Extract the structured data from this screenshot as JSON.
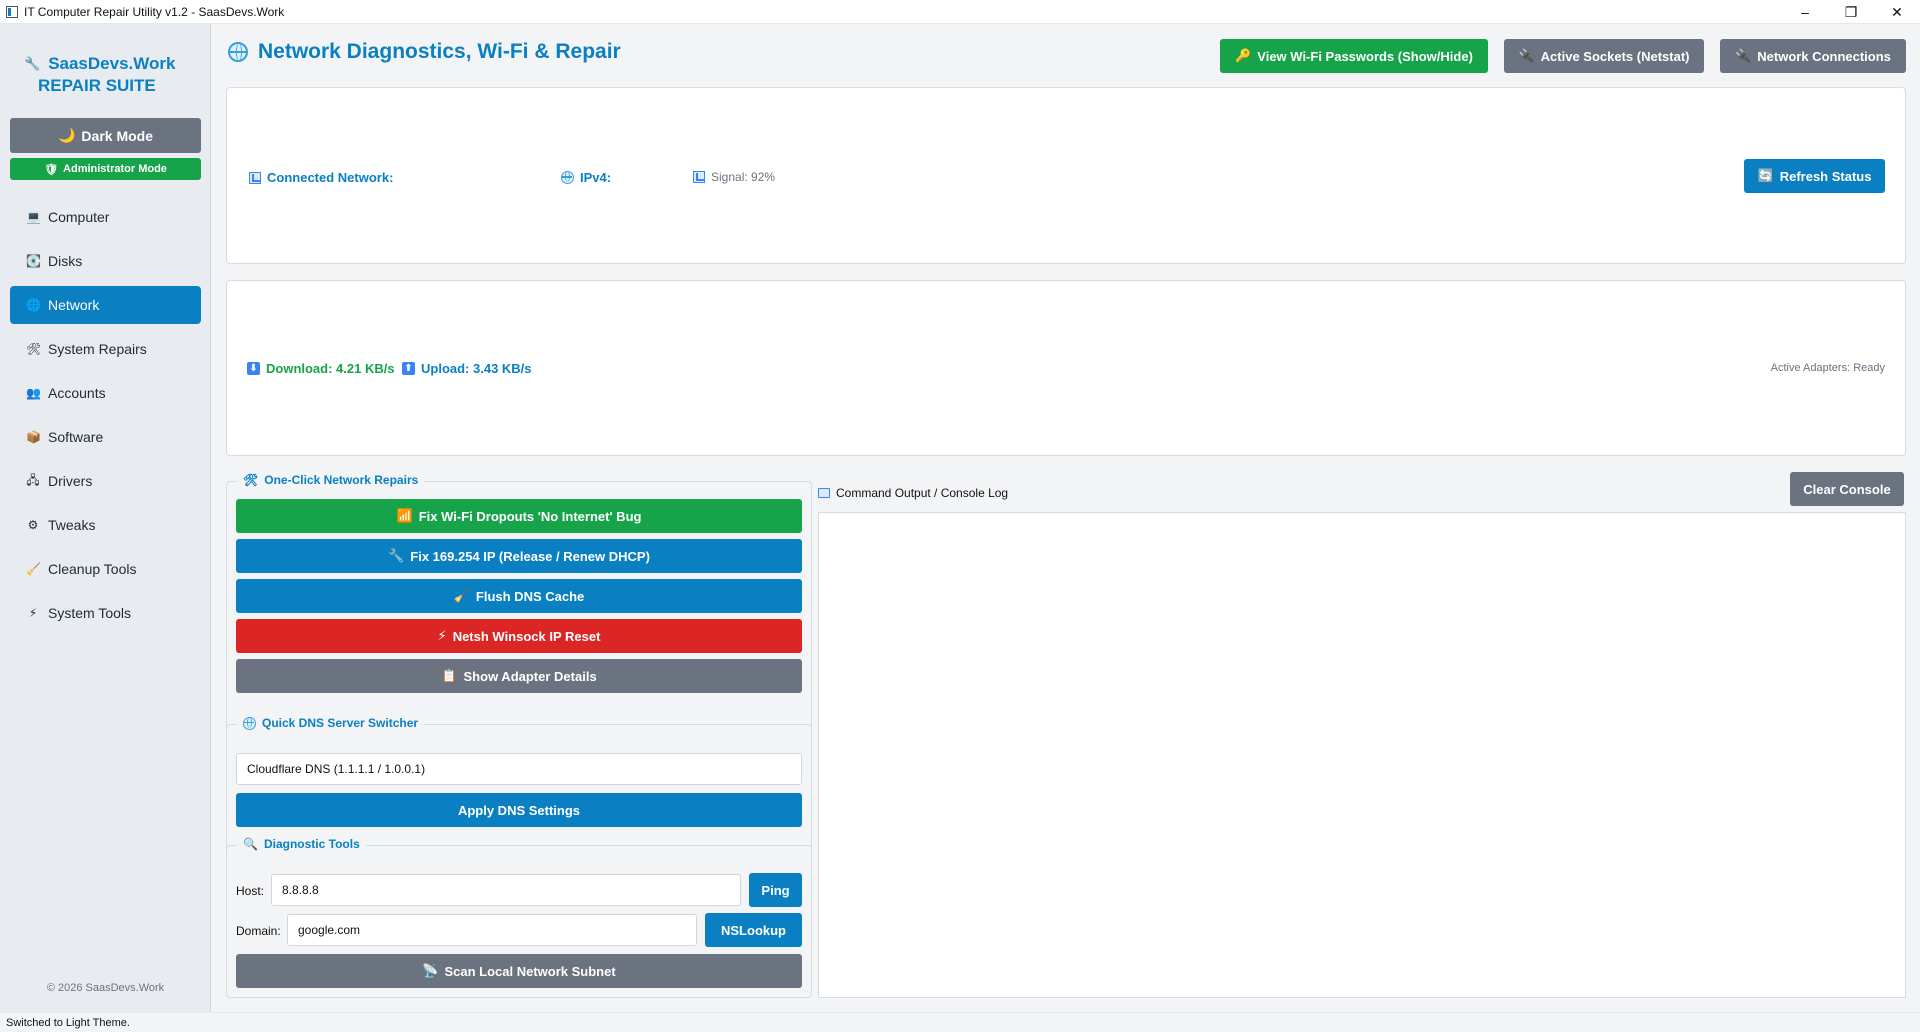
{
  "window": {
    "title": "IT Computer Repair Utility v1.2 - SaasDevs.Work",
    "minimize": "–",
    "maximize": "❐",
    "close": "✕"
  },
  "sidebar": {
    "brand_line1": "SaasDevs.Work",
    "brand_line2": "REPAIR SUITE",
    "dark_mode": "Dark Mode",
    "admin_mode": "Administrator Mode",
    "items": [
      {
        "label": "Computer",
        "icon": "💻"
      },
      {
        "label": "Disks",
        "icon": "💽"
      },
      {
        "label": "Network",
        "icon": "🌐"
      },
      {
        "label": "System Repairs",
        "icon": "🛠"
      },
      {
        "label": "Accounts",
        "icon": "👥"
      },
      {
        "label": "Software",
        "icon": "📦"
      },
      {
        "label": "Drivers",
        "icon": "🖧"
      },
      {
        "label": "Tweaks",
        "icon": "⚙"
      },
      {
        "label": "Cleanup Tools",
        "icon": "🧹"
      },
      {
        "label": "System Tools",
        "icon": "⚡"
      }
    ],
    "active_item": "Network",
    "copyright": "© 2026 SaasDevs.Work"
  },
  "header": {
    "title": "Network Diagnostics, Wi-Fi & Repair",
    "view_wifi_passwords": "View Wi-Fi Passwords (Show/Hide)",
    "active_sockets": "Active Sockets (Netstat)",
    "network_connections": "Network Connections"
  },
  "status": {
    "connected_label": "Connected Network:",
    "ipv4_label": "IPv4:",
    "signal": "Signal: 92%",
    "refresh": "Refresh Status"
  },
  "speed": {
    "download": "Download: 4.21 KB/s",
    "upload": "Upload: 3.43 KB/s",
    "adapters": "Active Adapters: Ready"
  },
  "repairs": {
    "legend": "One-Click Network Repairs",
    "fix_wifi": "Fix Wi-Fi Dropouts  'No Internet' Bug",
    "fix_ip": "Fix 169.254 IP (Release / Renew DHCP)",
    "flush_dns": "Flush DNS Cache",
    "winsock": "Netsh Winsock  IP Reset",
    "adapter_details": "Show Adapter Details"
  },
  "dns": {
    "legend": "Quick DNS Server Switcher",
    "selected": "Cloudflare DNS (1.1.1.1 / 1.0.0.1)",
    "apply": "Apply DNS Settings"
  },
  "diagnostics": {
    "legend": "Diagnostic Tools",
    "host_label": "Host:",
    "host_value": "8.8.8.8",
    "ping": "Ping",
    "domain_label": "Domain:",
    "domain_value": "google.com",
    "nslookup": "NSLookup",
    "scan": "Scan Local Network Subnet"
  },
  "console": {
    "title": "Command Output / Console Log",
    "clear": "Clear Console"
  },
  "statusbar": {
    "text": "Switched to Light Theme."
  },
  "colors": {
    "accent": "#0a7fc2",
    "success": "#16a34a",
    "danger": "#dc2626",
    "neutral": "#6b7280"
  }
}
